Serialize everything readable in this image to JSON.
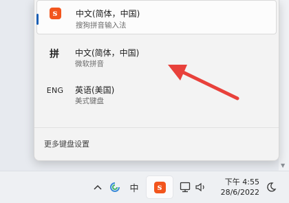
{
  "ime_menu": {
    "items": [
      {
        "icon": "sogou-logo-icon",
        "icon_text": "s",
        "title": "中文(简体，中国)",
        "subtitle": "搜狗拼音输入法"
      },
      {
        "icon": "pin-icon",
        "icon_text": "拼",
        "title": "中文(简体，中国)",
        "subtitle": "微软拼音"
      },
      {
        "icon": "eng-icon",
        "icon_text": "ENG",
        "title": "英语(美国)",
        "subtitle": "美式键盘"
      }
    ],
    "more_settings": "更多键盘设置"
  },
  "taskbar": {
    "tray_chevron": "^",
    "ime_mode_glyph": "中",
    "sogou_glyph": "s",
    "time": "下午 4:55",
    "date": "28/6/2022"
  },
  "colors": {
    "accent": "#1a5fb4",
    "sogou_orange": "#f2551d",
    "annotation_arrow": "#e8413b"
  }
}
